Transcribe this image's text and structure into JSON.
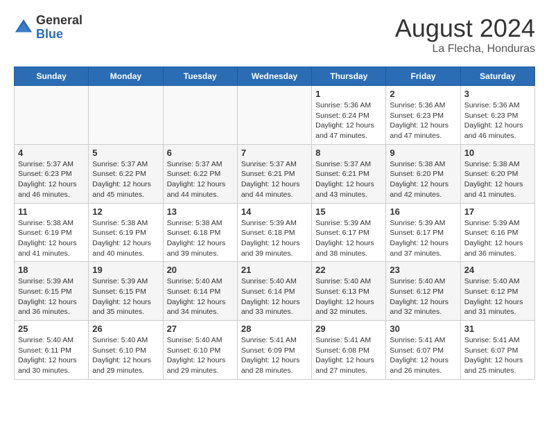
{
  "header": {
    "logo_general": "General",
    "logo_blue": "Blue",
    "month_year": "August 2024",
    "location": "La Flecha, Honduras"
  },
  "weekdays": [
    "Sunday",
    "Monday",
    "Tuesday",
    "Wednesday",
    "Thursday",
    "Friday",
    "Saturday"
  ],
  "weeks": [
    [
      {
        "day": "",
        "info": ""
      },
      {
        "day": "",
        "info": ""
      },
      {
        "day": "",
        "info": ""
      },
      {
        "day": "",
        "info": ""
      },
      {
        "day": "1",
        "info": "Sunrise: 5:36 AM\nSunset: 6:24 PM\nDaylight: 12 hours\nand 47 minutes."
      },
      {
        "day": "2",
        "info": "Sunrise: 5:36 AM\nSunset: 6:23 PM\nDaylight: 12 hours\nand 47 minutes."
      },
      {
        "day": "3",
        "info": "Sunrise: 5:36 AM\nSunset: 6:23 PM\nDaylight: 12 hours\nand 46 minutes."
      }
    ],
    [
      {
        "day": "4",
        "info": "Sunrise: 5:37 AM\nSunset: 6:23 PM\nDaylight: 12 hours\nand 46 minutes."
      },
      {
        "day": "5",
        "info": "Sunrise: 5:37 AM\nSunset: 6:22 PM\nDaylight: 12 hours\nand 45 minutes."
      },
      {
        "day": "6",
        "info": "Sunrise: 5:37 AM\nSunset: 6:22 PM\nDaylight: 12 hours\nand 44 minutes."
      },
      {
        "day": "7",
        "info": "Sunrise: 5:37 AM\nSunset: 6:21 PM\nDaylight: 12 hours\nand 44 minutes."
      },
      {
        "day": "8",
        "info": "Sunrise: 5:37 AM\nSunset: 6:21 PM\nDaylight: 12 hours\nand 43 minutes."
      },
      {
        "day": "9",
        "info": "Sunrise: 5:38 AM\nSunset: 6:20 PM\nDaylight: 12 hours\nand 42 minutes."
      },
      {
        "day": "10",
        "info": "Sunrise: 5:38 AM\nSunset: 6:20 PM\nDaylight: 12 hours\nand 41 minutes."
      }
    ],
    [
      {
        "day": "11",
        "info": "Sunrise: 5:38 AM\nSunset: 6:19 PM\nDaylight: 12 hours\nand 41 minutes."
      },
      {
        "day": "12",
        "info": "Sunrise: 5:38 AM\nSunset: 6:19 PM\nDaylight: 12 hours\nand 40 minutes."
      },
      {
        "day": "13",
        "info": "Sunrise: 5:38 AM\nSunset: 6:18 PM\nDaylight: 12 hours\nand 39 minutes."
      },
      {
        "day": "14",
        "info": "Sunrise: 5:39 AM\nSunset: 6:18 PM\nDaylight: 12 hours\nand 39 minutes."
      },
      {
        "day": "15",
        "info": "Sunrise: 5:39 AM\nSunset: 6:17 PM\nDaylight: 12 hours\nand 38 minutes."
      },
      {
        "day": "16",
        "info": "Sunrise: 5:39 AM\nSunset: 6:17 PM\nDaylight: 12 hours\nand 37 minutes."
      },
      {
        "day": "17",
        "info": "Sunrise: 5:39 AM\nSunset: 6:16 PM\nDaylight: 12 hours\nand 36 minutes."
      }
    ],
    [
      {
        "day": "18",
        "info": "Sunrise: 5:39 AM\nSunset: 6:15 PM\nDaylight: 12 hours\nand 36 minutes."
      },
      {
        "day": "19",
        "info": "Sunrise: 5:39 AM\nSunset: 6:15 PM\nDaylight: 12 hours\nand 35 minutes."
      },
      {
        "day": "20",
        "info": "Sunrise: 5:40 AM\nSunset: 6:14 PM\nDaylight: 12 hours\nand 34 minutes."
      },
      {
        "day": "21",
        "info": "Sunrise: 5:40 AM\nSunset: 6:14 PM\nDaylight: 12 hours\nand 33 minutes."
      },
      {
        "day": "22",
        "info": "Sunrise: 5:40 AM\nSunset: 6:13 PM\nDaylight: 12 hours\nand 32 minutes."
      },
      {
        "day": "23",
        "info": "Sunrise: 5:40 AM\nSunset: 6:12 PM\nDaylight: 12 hours\nand 32 minutes."
      },
      {
        "day": "24",
        "info": "Sunrise: 5:40 AM\nSunset: 6:12 PM\nDaylight: 12 hours\nand 31 minutes."
      }
    ],
    [
      {
        "day": "25",
        "info": "Sunrise: 5:40 AM\nSunset: 6:11 PM\nDaylight: 12 hours\nand 30 minutes."
      },
      {
        "day": "26",
        "info": "Sunrise: 5:40 AM\nSunset: 6:10 PM\nDaylight: 12 hours\nand 29 minutes."
      },
      {
        "day": "27",
        "info": "Sunrise: 5:40 AM\nSunset: 6:10 PM\nDaylight: 12 hours\nand 29 minutes."
      },
      {
        "day": "28",
        "info": "Sunrise: 5:41 AM\nSunset: 6:09 PM\nDaylight: 12 hours\nand 28 minutes."
      },
      {
        "day": "29",
        "info": "Sunrise: 5:41 AM\nSunset: 6:08 PM\nDaylight: 12 hours\nand 27 minutes."
      },
      {
        "day": "30",
        "info": "Sunrise: 5:41 AM\nSunset: 6:07 PM\nDaylight: 12 hours\nand 26 minutes."
      },
      {
        "day": "31",
        "info": "Sunrise: 5:41 AM\nSunset: 6:07 PM\nDaylight: 12 hours\nand 25 minutes."
      }
    ]
  ]
}
